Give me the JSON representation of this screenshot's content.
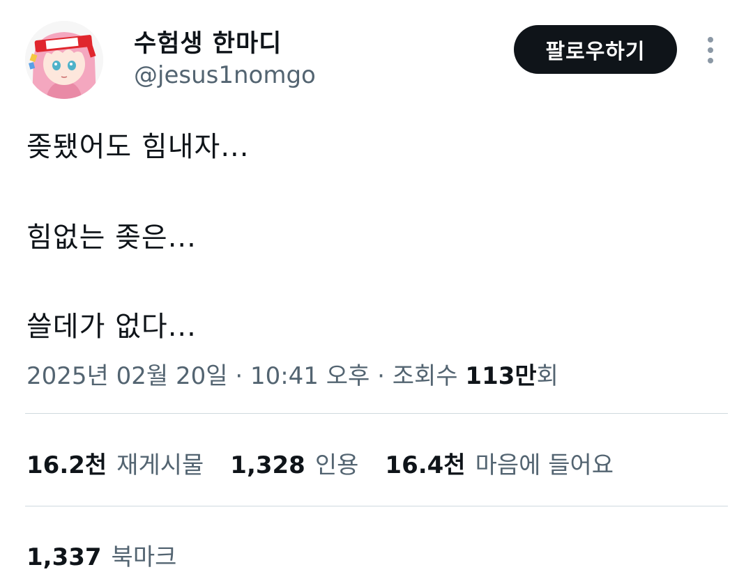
{
  "profile": {
    "display_name": "수험생 한마디",
    "handle": "@jesus1nomgo"
  },
  "follow_button": {
    "label": "팔로우하기"
  },
  "more_button": {
    "icon": "more-vertical-icon"
  },
  "tweet": {
    "lines": [
      "좆됐어도 힘내자...",
      "힘없는 좆은...",
      "쓸데가 없다..."
    ]
  },
  "meta": {
    "date": "2025년 02월 20일",
    "sep1": " · ",
    "time": "10:41 오후",
    "sep2": " · ",
    "views_prefix": "조회수 ",
    "views_value": "113만",
    "views_suffix": "회"
  },
  "stats": [
    {
      "value": "16.2천",
      "label": "재게시물"
    },
    {
      "value": "1,328",
      "label": "인용"
    },
    {
      "value": "16.4천",
      "label": "마음에 들어요"
    }
  ],
  "bookmarks": {
    "value": "1,337",
    "label": "북마크"
  },
  "colors": {
    "text": "#0f1419",
    "secondary": "#536471",
    "divider": "#cfd9de",
    "button_bg": "#0f1419"
  }
}
